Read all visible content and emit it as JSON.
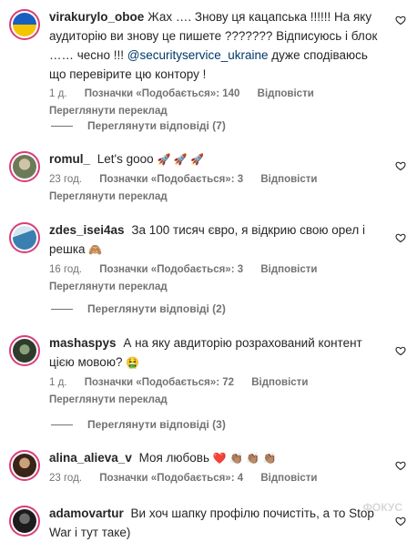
{
  "comments": [
    {
      "username": "virakurylo_oboe",
      "text_parts": [
        "Жах …. Знову ця кацапська !!!!!! На яку аудиторію ви знову це пишете ??????? Відписуюсь і блок …… чесно !!! ",
        "@securityservice_ukraine",
        " дуже сподіваюсь що перевірите цю контору !"
      ],
      "time": "1 д.",
      "likes": "Позначки «Подобається»: 140",
      "reply": "Відповісти",
      "translate": "Переглянути переклад",
      "view_replies": "Переглянути відповіді (7)",
      "avatar_colors": [
        "#1a5fbf",
        "#f5c400"
      ]
    },
    {
      "username": "romul_",
      "text": "Let's gooo",
      "emojis": "🚀 🚀 🚀",
      "time": "23 год.",
      "likes": "Позначки «Подобається»: 3",
      "reply": "Відповісти",
      "translate": "Переглянути переклад",
      "avatar_colors": [
        "#6d7a5a",
        "#cfc4a8"
      ]
    },
    {
      "username": "zdes_isei4as",
      "text": "За 100 тисяч євро, я відкрию свою орел і решка",
      "emoji": "🙈",
      "time": "16 год.",
      "likes": "Позначки «Подобається»: 3",
      "reply": "Відповісти",
      "translate": "Переглянути переклад",
      "view_replies": "Переглянути відповіді (2)",
      "avatar_colors": [
        "#3a7fb0",
        "#d6e6ef"
      ]
    },
    {
      "username": "mashaspys",
      "text": "А на яку авдиторію розрахований контент цією мовою?",
      "emoji": "🤮",
      "time": "1 д.",
      "likes": "Позначки «Подобається»: 72",
      "reply": "Відповісти",
      "translate": "Переглянути переклад",
      "view_replies": "Переглянути відповіді (3)",
      "avatar_colors": [
        "#2f3b2a",
        "#8aa07a"
      ]
    },
    {
      "username": "alina_alieva_v",
      "text": "Моя любовь",
      "emojis": "❤️ 👏🏽 👏🏽 👏🏽",
      "time": "23 год.",
      "likes": "Позначки «Подобається»: 4",
      "reply": "Відповісти",
      "avatar_colors": [
        "#3a2418",
        "#c9a27c"
      ]
    },
    {
      "username": "adamovartur",
      "text": "Ви хоч шапку профілю почистіть, а то Stop War і тут таке)",
      "avatar_colors": [
        "#1c1c1c",
        "#6b6b6b"
      ]
    }
  ],
  "colors": {
    "story_ring": "#d93d7a",
    "mention": "#00376b",
    "secondary": "#737373"
  },
  "watermark": "ФОКУС"
}
